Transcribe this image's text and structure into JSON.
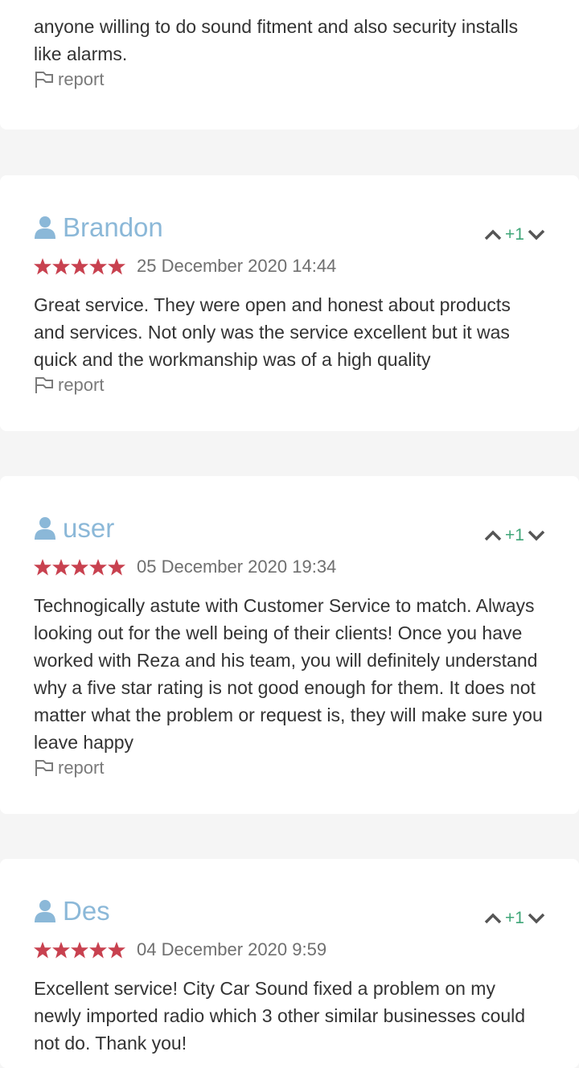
{
  "reviews": [
    {
      "text": "anyone willing to do sound fitment and also security installs like alarms.",
      "report": "report"
    },
    {
      "user": "Brandon",
      "votes": "+1",
      "rating": 5,
      "date": "25 December 2020 14:44",
      "text": "Great service. They were open and honest about products and services. Not only was the service excellent but it was quick and the workmanship was of a high quality",
      "report": "report"
    },
    {
      "user": "user",
      "votes": "+1",
      "rating": 5,
      "date": "05 December 2020 19:34",
      "text": "Technogically astute with Customer Service to match. Always looking out for the well being of their clients! Once you have worked with Reza and his team, you will definitely understand why a five star rating is not good enough for them. It does not matter what the problem or request is, they will make sure you leave happy",
      "report": "report"
    },
    {
      "user": "Des",
      "votes": "+1",
      "rating": 5,
      "date": "04 December 2020 9:59",
      "text": "Excellent service! City Car Sound fixed a problem on my newly imported radio which 3 other similar businesses could not do. Thank you!"
    }
  ],
  "colors": {
    "star": "#c8414f",
    "username": "#8bb8d8",
    "vote_count": "#3fa678",
    "background": "#f5f5f5"
  },
  "icons": {
    "user": "user-icon",
    "star": "star-icon",
    "upvote": "chevron-up-icon",
    "downvote": "chevron-down-icon",
    "report": "flag-icon"
  }
}
